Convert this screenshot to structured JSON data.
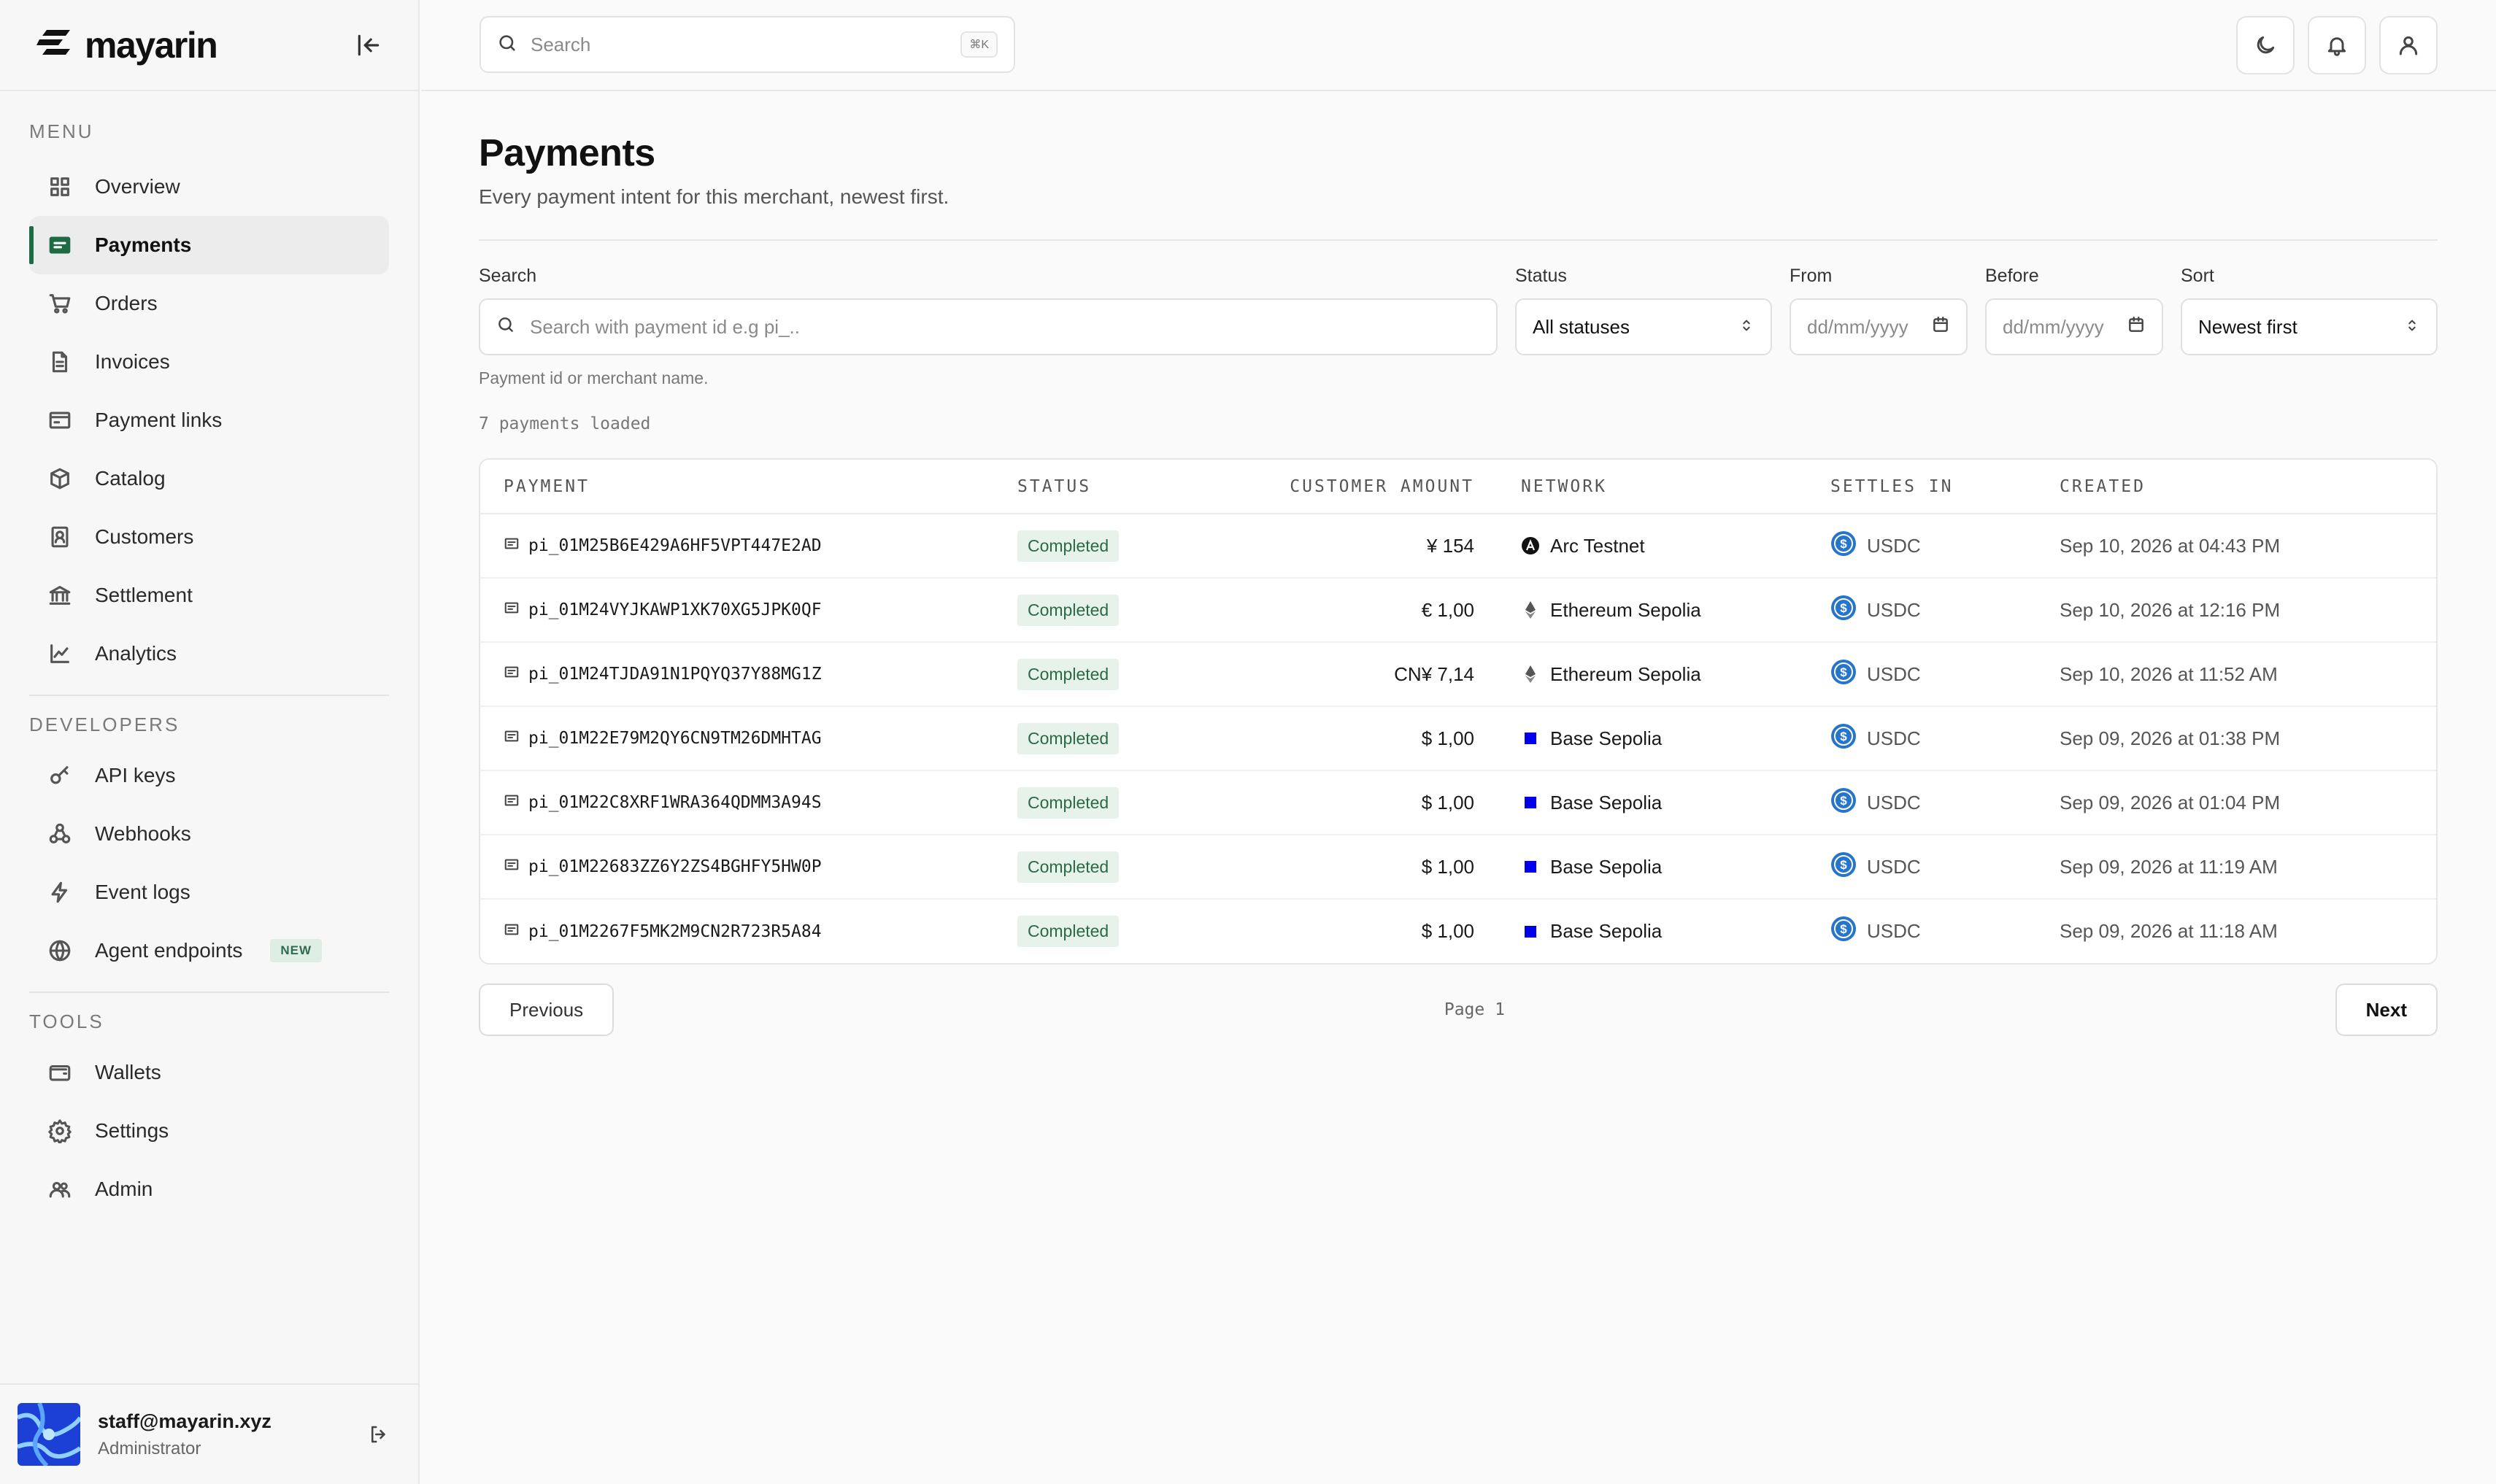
{
  "brand": {
    "name": "mayarin"
  },
  "sidebar": {
    "menu_label": "MENU",
    "menu_items": [
      {
        "label": "Overview",
        "icon": "grid-icon"
      },
      {
        "label": "Payments",
        "icon": "card-icon",
        "active": true
      },
      {
        "label": "Orders",
        "icon": "cart-icon"
      },
      {
        "label": "Invoices",
        "icon": "document-icon"
      },
      {
        "label": "Payment links",
        "icon": "inbox-icon"
      },
      {
        "label": "Catalog",
        "icon": "box-icon"
      },
      {
        "label": "Customers",
        "icon": "contact-icon"
      },
      {
        "label": "Settlement",
        "icon": "bank-icon"
      },
      {
        "label": "Analytics",
        "icon": "chart-icon"
      }
    ],
    "developers_label": "DEVELOPERS",
    "developer_items": [
      {
        "label": "API keys",
        "icon": "key-icon"
      },
      {
        "label": "Webhooks",
        "icon": "webhook-icon"
      },
      {
        "label": "Event logs",
        "icon": "bolt-icon"
      },
      {
        "label": "Agent endpoints",
        "icon": "globe-icon",
        "badge": "NEW"
      }
    ],
    "tools_label": "TOOLS",
    "tool_items": [
      {
        "label": "Wallets",
        "icon": "wallet-icon"
      },
      {
        "label": "Settings",
        "icon": "gear-icon"
      },
      {
        "label": "Admin",
        "icon": "users-icon"
      }
    ]
  },
  "user": {
    "email": "staff@mayarin.xyz",
    "role": "Administrator"
  },
  "topbar": {
    "search_placeholder": "Search",
    "shortcut": "⌘K"
  },
  "page": {
    "title": "Payments",
    "subtitle": "Every payment intent for this merchant, newest first."
  },
  "filters": {
    "search_label": "Search",
    "search_placeholder": "Search with payment id e.g pi_..",
    "search_hint": "Payment id or merchant name.",
    "status_label": "Status",
    "status_value": "All statuses",
    "from_label": "From",
    "from_placeholder": "dd/mm/yyyy",
    "before_label": "Before",
    "before_placeholder": "dd/mm/yyyy",
    "sort_label": "Sort",
    "sort_value": "Newest first"
  },
  "loaded_text": "7 payments loaded",
  "table": {
    "headers": [
      "PAYMENT",
      "STATUS",
      "CUSTOMER AMOUNT",
      "NETWORK",
      "SETTLES IN",
      "CREATED"
    ],
    "rows": [
      {
        "id": "pi_01M25B6E429A6HF5VPT447E2AD",
        "status": "Completed",
        "amount": "¥ 154",
        "network": "Arc Testnet",
        "network_icon": "arc-icon",
        "settles": "USDC",
        "created": "Sep 10, 2026 at 04:43 PM"
      },
      {
        "id": "pi_01M24VYJKAWP1XK70XG5JPK0QF",
        "status": "Completed",
        "amount": "€ 1,00",
        "network": "Ethereum Sepolia",
        "network_icon": "ethereum-icon",
        "settles": "USDC",
        "created": "Sep 10, 2026 at 12:16 PM"
      },
      {
        "id": "pi_01M24TJDA91N1PQYQ37Y88MG1Z",
        "status": "Completed",
        "amount": "CN¥ 7,14",
        "network": "Ethereum Sepolia",
        "network_icon": "ethereum-icon",
        "settles": "USDC",
        "created": "Sep 10, 2026 at 11:52 AM"
      },
      {
        "id": "pi_01M22E79M2QY6CN9TM26DMHTAG",
        "status": "Completed",
        "amount": "$ 1,00",
        "network": "Base Sepolia",
        "network_icon": "base-icon",
        "settles": "USDC",
        "created": "Sep 09, 2026 at 01:38 PM"
      },
      {
        "id": "pi_01M22C8XRF1WRA364QDMM3A94S",
        "status": "Completed",
        "amount": "$ 1,00",
        "network": "Base Sepolia",
        "network_icon": "base-icon",
        "settles": "USDC",
        "created": "Sep 09, 2026 at 01:04 PM"
      },
      {
        "id": "pi_01M22683ZZ6Y2ZS4BGHFY5HW0P",
        "status": "Completed",
        "amount": "$ 1,00",
        "network": "Base Sepolia",
        "network_icon": "base-icon",
        "settles": "USDC",
        "created": "Sep 09, 2026 at 11:19 AM"
      },
      {
        "id": "pi_01M2267F5MK2M9CN2R723R5A84",
        "status": "Completed",
        "amount": "$ 1,00",
        "network": "Base Sepolia",
        "network_icon": "base-icon",
        "settles": "USDC",
        "created": "Sep 09, 2026 at 11:18 AM"
      }
    ]
  },
  "pagination": {
    "previous": "Previous",
    "page": "Page 1",
    "next": "Next"
  },
  "colors": {
    "accent": "#1f6b46",
    "status_bg": "#e6f2ea",
    "status_text": "#2a6a45",
    "base_blue": "#0000ee",
    "usdc_blue": "#2775ca"
  }
}
